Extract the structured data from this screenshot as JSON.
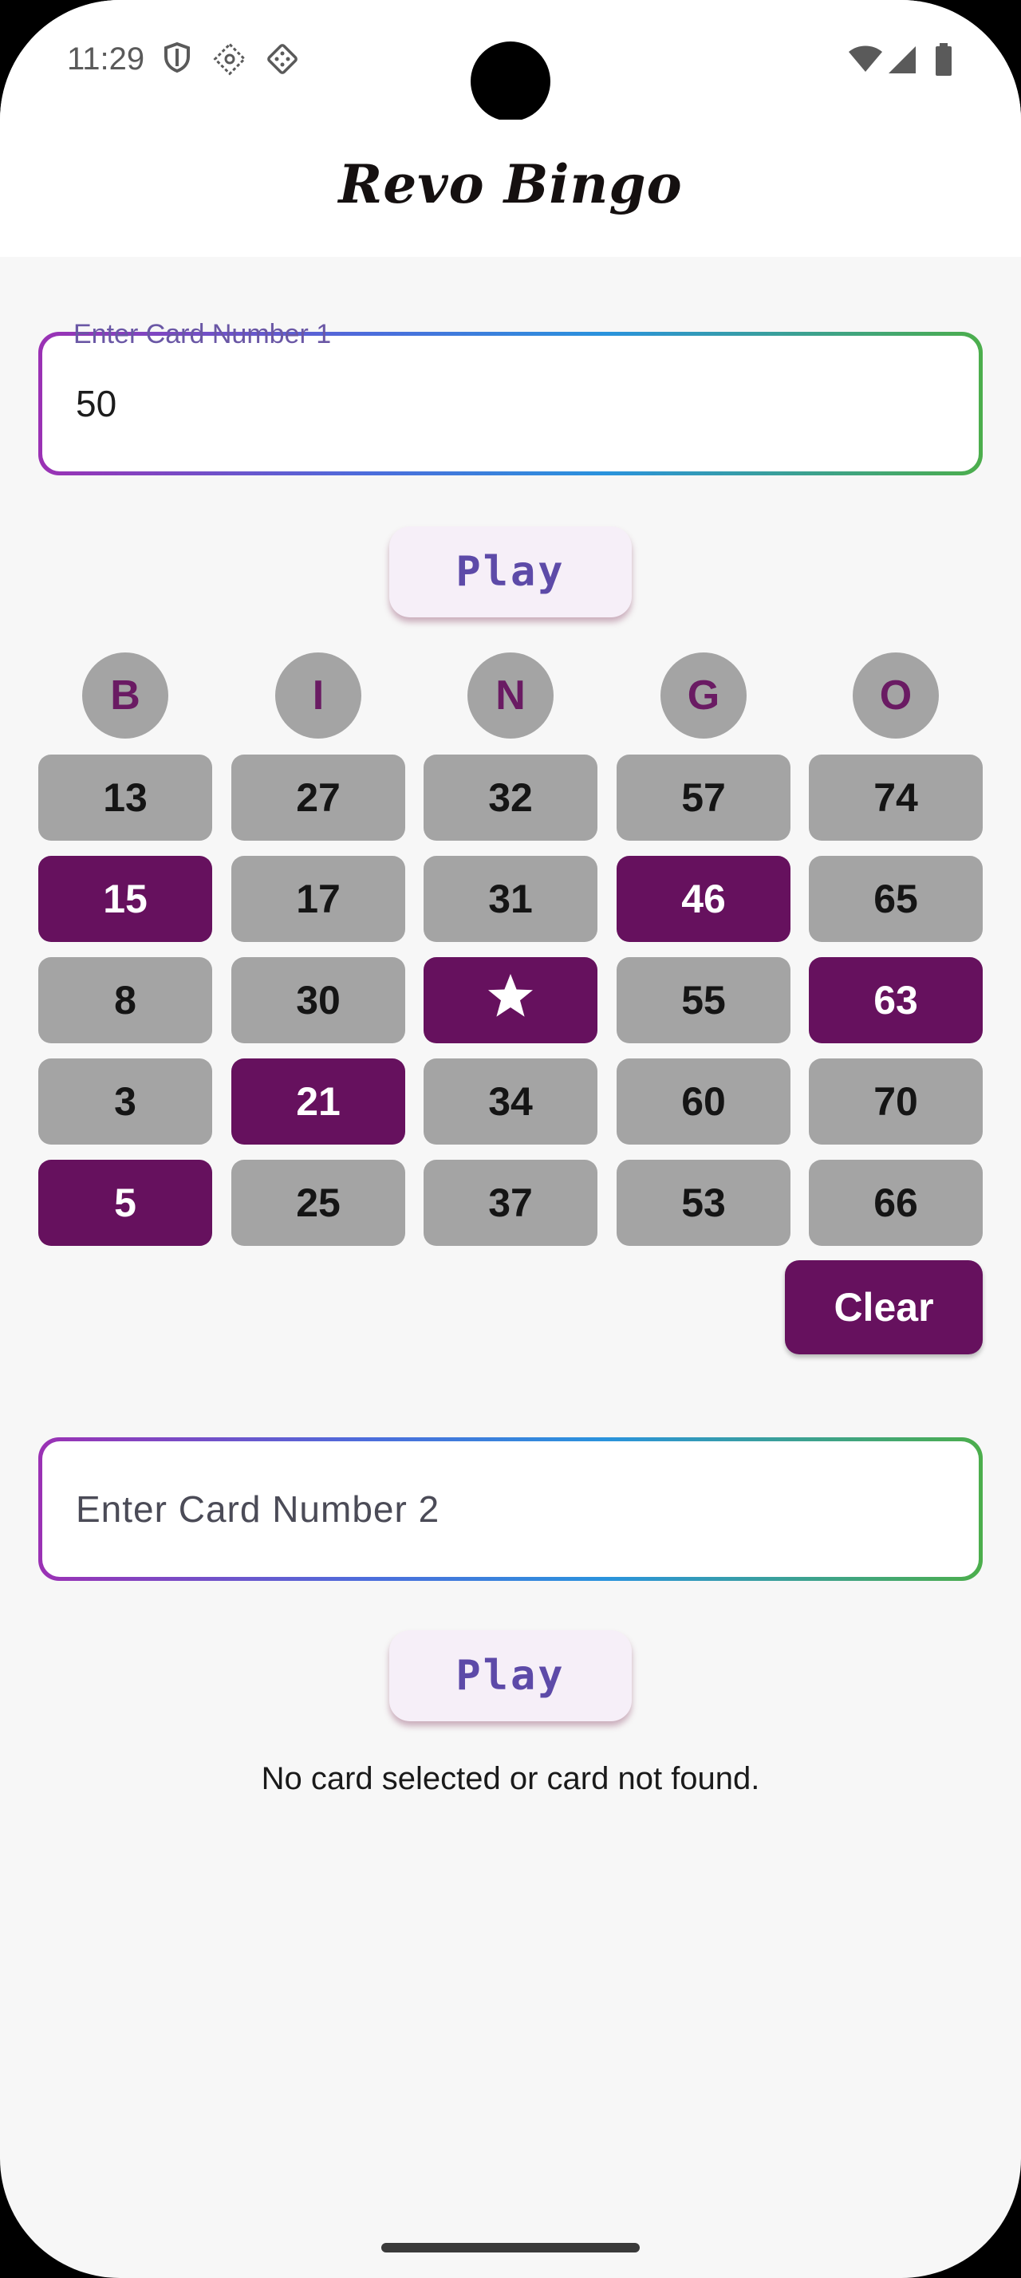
{
  "status_bar": {
    "time": "11:29",
    "icons": [
      "shield-icon",
      "diamond-tag-icon",
      "dice-icon",
      "wifi-icon",
      "signal-icon",
      "battery-icon"
    ]
  },
  "app_bar": {
    "title": "Revo Bingo"
  },
  "card1": {
    "label": "Enter Card Number 1",
    "value": "50",
    "play_label": "Play"
  },
  "bingo": {
    "headers": [
      "B",
      "I",
      "N",
      "G",
      "O"
    ],
    "rows": [
      [
        {
          "v": "13",
          "m": false
        },
        {
          "v": "27",
          "m": false
        },
        {
          "v": "32",
          "m": false
        },
        {
          "v": "57",
          "m": false
        },
        {
          "v": "74",
          "m": false
        }
      ],
      [
        {
          "v": "15",
          "m": true
        },
        {
          "v": "17",
          "m": false
        },
        {
          "v": "31",
          "m": false
        },
        {
          "v": "46",
          "m": true
        },
        {
          "v": "65",
          "m": false
        }
      ],
      [
        {
          "v": "8",
          "m": false
        },
        {
          "v": "30",
          "m": false
        },
        {
          "v": "",
          "m": true,
          "icon": "star-icon"
        },
        {
          "v": "55",
          "m": false
        },
        {
          "v": "63",
          "m": true
        }
      ],
      [
        {
          "v": "3",
          "m": false
        },
        {
          "v": "21",
          "m": true
        },
        {
          "v": "34",
          "m": false
        },
        {
          "v": "60",
          "m": false
        },
        {
          "v": "70",
          "m": false
        }
      ],
      [
        {
          "v": "5",
          "m": true
        },
        {
          "v": "25",
          "m": false
        },
        {
          "v": "37",
          "m": false
        },
        {
          "v": "53",
          "m": false
        },
        {
          "v": "66",
          "m": false
        }
      ]
    ],
    "clear_label": "Clear"
  },
  "card2": {
    "placeholder": "Enter Card Number 2",
    "play_label": "Play",
    "status": "No card selected or card not found."
  },
  "colors": {
    "marked": "#66115e",
    "unmarked": "#a4a4a4",
    "header_letter": "#6a1b63",
    "play_text": "#5d4aa8"
  }
}
